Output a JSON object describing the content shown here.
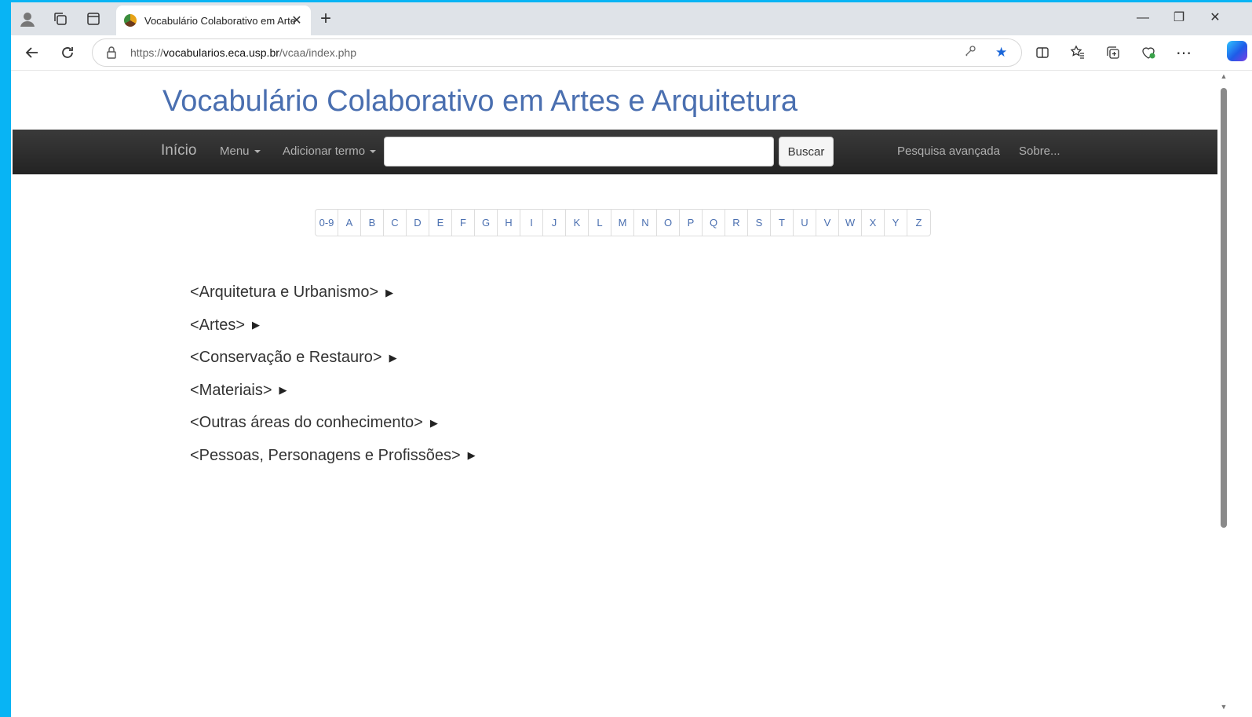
{
  "browser": {
    "tab_title": "Vocabulário Colaborativo em Arte",
    "url_prefix": "https://",
    "url_host": "vocabularios.eca.usp.br",
    "url_path": "/vcaa/index.php"
  },
  "site": {
    "title": "Vocabulário Colaborativo em Artes e Arquitetura"
  },
  "nav": {
    "brand": "Início",
    "menu": "Menu",
    "add_term": "Adicionar termo",
    "search_placeholder": "",
    "search_button": "Buscar",
    "advanced_search": "Pesquisa avançada",
    "about": "Sobre..."
  },
  "alphabet": [
    "0-9",
    "A",
    "B",
    "C",
    "D",
    "E",
    "F",
    "G",
    "H",
    "I",
    "J",
    "K",
    "L",
    "M",
    "N",
    "O",
    "P",
    "Q",
    "R",
    "S",
    "T",
    "U",
    "V",
    "W",
    "X",
    "Y",
    "Z"
  ],
  "tree": [
    "<Arquitetura e Urbanismo>",
    "<Artes>",
    "<Conservação e Restauro>",
    "<Materiais>",
    "<Outras áreas do conhecimento>",
    "<Pessoas, Personagens e Profissões>"
  ],
  "tree_arrow": "▶",
  "colors": {
    "title": "#4a6fb0",
    "navbar": "#2b2b2b",
    "desktop": "#08b4f4"
  }
}
